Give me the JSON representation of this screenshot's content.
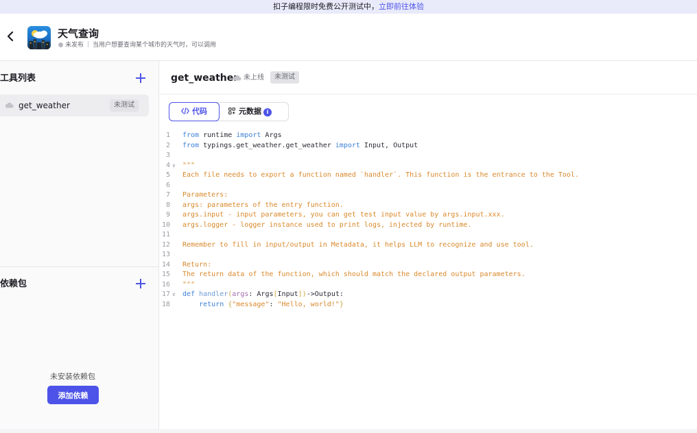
{
  "banner": {
    "text": "扣子编程限时免费公开测试中，",
    "link": "立即前往体验"
  },
  "header": {
    "title": "天气查询",
    "status": "未发布",
    "description": "当用户想要查询某个城市的天气时，可以调用"
  },
  "sidebar": {
    "tools_title": "工具列表",
    "tools": [
      {
        "name": "get_weather",
        "badge": "未测试"
      }
    ],
    "deps_title": "依赖包",
    "deps_empty": "未安装依赖包",
    "add_dep_label": "添加依赖"
  },
  "content": {
    "title": "get_weather",
    "online_status": "未上线",
    "test_badge": "未测试",
    "tabs": [
      {
        "label": "代码",
        "icon": "code-icon",
        "active": true
      },
      {
        "label": "元数据",
        "icon": "metadata-grid-icon",
        "active": false,
        "info": "i"
      }
    ]
  },
  "code_lines": [
    {
      "n": "1",
      "fold": "",
      "tokens": [
        [
          "kw",
          "from"
        ],
        [
          "plain",
          " runtime "
        ],
        [
          "kw",
          "import"
        ],
        [
          "plain",
          " Args"
        ]
      ]
    },
    {
      "n": "2",
      "fold": "",
      "tokens": [
        [
          "kw",
          "from"
        ],
        [
          "plain",
          " typings.get_weather.get_weather "
        ],
        [
          "kw",
          "import"
        ],
        [
          "plain",
          " Input, Output"
        ]
      ]
    },
    {
      "n": "3",
      "fold": "",
      "tokens": []
    },
    {
      "n": "4",
      "fold": "v",
      "tokens": [
        [
          "str",
          "\"\"\""
        ]
      ]
    },
    {
      "n": "5",
      "fold": "",
      "tokens": [
        [
          "str",
          "Each file needs to export a function named `handler`. This function is the entrance to the Tool."
        ]
      ]
    },
    {
      "n": "6",
      "fold": "",
      "tokens": []
    },
    {
      "n": "7",
      "fold": "",
      "tokens": [
        [
          "str",
          "Parameters:"
        ]
      ]
    },
    {
      "n": "8",
      "fold": "",
      "tokens": [
        [
          "str",
          "args: parameters of the entry function."
        ]
      ]
    },
    {
      "n": "9",
      "fold": "",
      "tokens": [
        [
          "str",
          "args.input - input parameters, you can get test input value by args.input.xxx."
        ]
      ]
    },
    {
      "n": "10",
      "fold": "",
      "tokens": [
        [
          "str",
          "args.logger - logger instance used to print logs, injected by runtime."
        ]
      ]
    },
    {
      "n": "11",
      "fold": "",
      "tokens": []
    },
    {
      "n": "12",
      "fold": "",
      "tokens": [
        [
          "str",
          "Remember to fill in input/output in Metadata, it helps LLM to recognize and use tool."
        ]
      ]
    },
    {
      "n": "13",
      "fold": "",
      "tokens": []
    },
    {
      "n": "14",
      "fold": "",
      "tokens": [
        [
          "str",
          "Return:"
        ]
      ]
    },
    {
      "n": "15",
      "fold": "",
      "tokens": [
        [
          "str",
          "The return data of the function, which should match the declared output parameters."
        ]
      ]
    },
    {
      "n": "16",
      "fold": "",
      "tokens": [
        [
          "str",
          "\"\"\""
        ]
      ]
    },
    {
      "n": "17",
      "fold": "v",
      "tokens": [
        [
          "kw",
          "def"
        ],
        [
          "plain",
          " "
        ],
        [
          "fn",
          "handler"
        ],
        [
          "brk",
          "("
        ],
        [
          "par",
          "args"
        ],
        [
          "plain",
          ": Args"
        ],
        [
          "brk",
          "["
        ],
        [
          "plain",
          "Input"
        ],
        [
          "brk",
          "]"
        ],
        [
          "brk",
          ")"
        ],
        [
          "plain",
          "->Output:"
        ]
      ]
    },
    {
      "n": "18",
      "fold": "",
      "tokens": [
        [
          "plain",
          "    "
        ],
        [
          "kw",
          "return"
        ],
        [
          "plain",
          " "
        ],
        [
          "brk",
          "{"
        ],
        [
          "str",
          "\"message\""
        ],
        [
          "plain",
          ": "
        ],
        [
          "str",
          "\"Hello, world!\""
        ],
        [
          "brk",
          "}"
        ]
      ]
    }
  ],
  "colors": {
    "accent": "#4d53e8",
    "keyword": "#3b7fd6",
    "string": "#d9882a"
  }
}
